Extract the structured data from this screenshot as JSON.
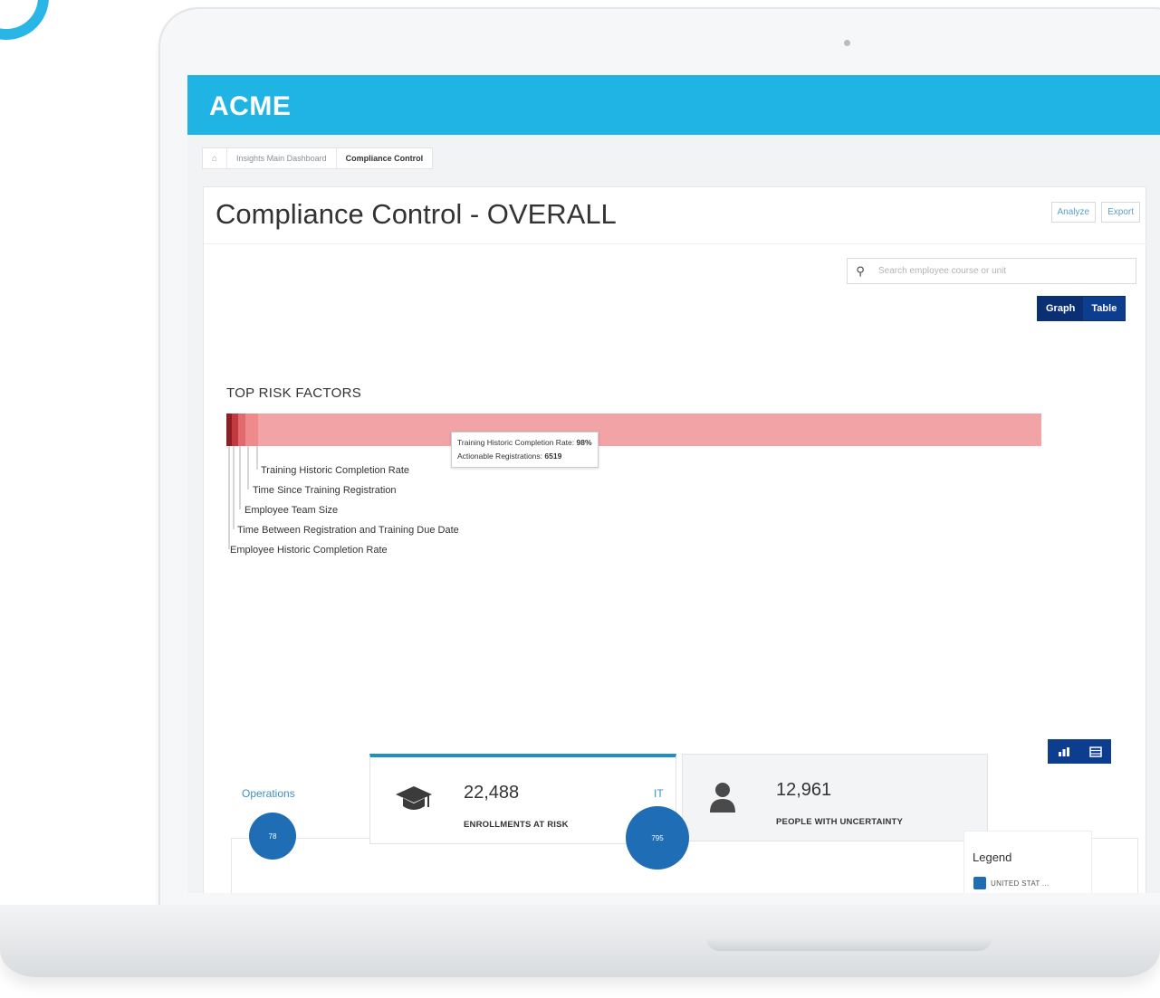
{
  "app": {
    "title": "ACME",
    "brand_color": "#1fb4e4"
  },
  "breadcrumb": {
    "items": [
      "Insights Main Dashboard",
      "Compliance Control"
    ]
  },
  "page": {
    "title": "Compliance Control - OVERALL",
    "actions": [
      "Analyze",
      "Export"
    ],
    "search_placeholder": "Search employee course or unit",
    "view_toggle": [
      "Graph",
      "Table"
    ]
  },
  "risk": {
    "heading": "TOP RISK FACTORS",
    "factors": [
      "Training Historic Completion Rate",
      "Time Since Training Registration",
      "Employee Team Size",
      "Time Between Registration and Training Due Date",
      "Employee Historic Completion Rate"
    ],
    "tooltip": {
      "line1_label": "Training Historic Completion Rate:",
      "line1_value": "98%",
      "line2_label": "Actionable Registrations:",
      "line2_value": "6519"
    }
  },
  "stats": [
    {
      "value": "22,488",
      "label": "ENROLLMENTS AT RISK",
      "icon": "graduation-cap-icon"
    },
    {
      "value": "12,961",
      "label": "PEOPLE WITH UNCERTAINTY",
      "icon": "person-icon"
    }
  ],
  "departments": [
    {
      "name": "Operations",
      "value": "78"
    },
    {
      "name": "IT",
      "value": "795"
    }
  ],
  "legend": {
    "title": "Legend",
    "item": "UNITED STAT ..."
  }
}
